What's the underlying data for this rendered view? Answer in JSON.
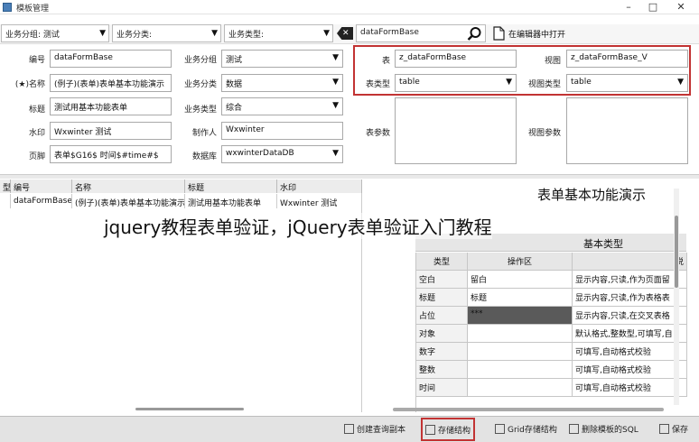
{
  "window": {
    "title": "模板管理",
    "minimize": "–",
    "maximize": "□",
    "close": "✕"
  },
  "filters": {
    "group_label": "业务分组:",
    "group_value": "测试",
    "category_label": "业务分类:",
    "type_label": "业务类型:",
    "search_value": "dataFormBase",
    "open_in_editor": "在编辑器中打开"
  },
  "form": {
    "code_label": "编号",
    "code_value": "dataFormBase",
    "name_label": "(★)名称",
    "name_value": "(例子)(表单)表单基本功能演示",
    "title_label": "标题",
    "title_value": "测试用基本功能表单",
    "watermark_label": "水印",
    "watermark_value": "Wxwinter 测试",
    "footer_label": "页脚",
    "footer_value": "表单$G16$ 时间$#time#$",
    "biz_group_label": "业务分组",
    "biz_group_value": "测试",
    "biz_cat_label": "业务分类",
    "biz_cat_value": "数据",
    "biz_type_label": "业务类型",
    "biz_type_value": "综合",
    "author_label": "制作人",
    "author_value": "Wxwinter",
    "db_label": "数据库",
    "db_value": "wxwinterDataDB",
    "table_label": "表",
    "table_value": "z_dataFormBase",
    "view_label": "视图",
    "view_value": "z_dataFormBase_V",
    "table_type_label": "表类型",
    "table_type_value": "table",
    "view_type_label": "视图类型",
    "view_type_value": "table",
    "table_params_label": "表参数",
    "view_params_label": "视图参数"
  },
  "grid": {
    "columns": [
      "型",
      "编号",
      "名称",
      "标题",
      "水印"
    ],
    "rows": [
      [
        "",
        "dataFormBase",
        "(例子)(表单)表单基本功能演示",
        "测试用基本功能表单",
        "Wxwinter 测试"
      ]
    ]
  },
  "preview": {
    "heading": "表单基本功能演示",
    "subheading": "基本类型",
    "col_type": "类型",
    "col_area": "操作区",
    "col_desc": "说",
    "rows": [
      {
        "type": "空白",
        "area": "留白",
        "desc": "显示内容,只读,作为页面留"
      },
      {
        "type": "标题",
        "area": "标题",
        "desc": "显示内容,只读,作为表格表"
      },
      {
        "type": "占位",
        "area": "***",
        "desc": "显示内容,只读,在交叉表格"
      },
      {
        "type": "对象",
        "area": "",
        "desc": "默认格式,整数型,可填写,自"
      },
      {
        "type": "数字",
        "area": "",
        "desc": "可填写,自动格式校验"
      },
      {
        "type": "整数",
        "area": "",
        "desc": "可填写,自动格式校验"
      },
      {
        "type": "时间",
        "area": "",
        "desc": "可填写,自动格式校验"
      }
    ]
  },
  "overlay_text": "jquery教程表单验证，jQuery表单验证入门教程",
  "status_buttons": {
    "create_query": "创建查询副本",
    "save_structure": "存储结构",
    "grid_save": "Grid存储结构",
    "delete_sql": "删除模板的SQL",
    "save": "保存"
  },
  "colors": {
    "highlight_border": "#c23333",
    "placeholder_cell": "#5a5a5a"
  }
}
